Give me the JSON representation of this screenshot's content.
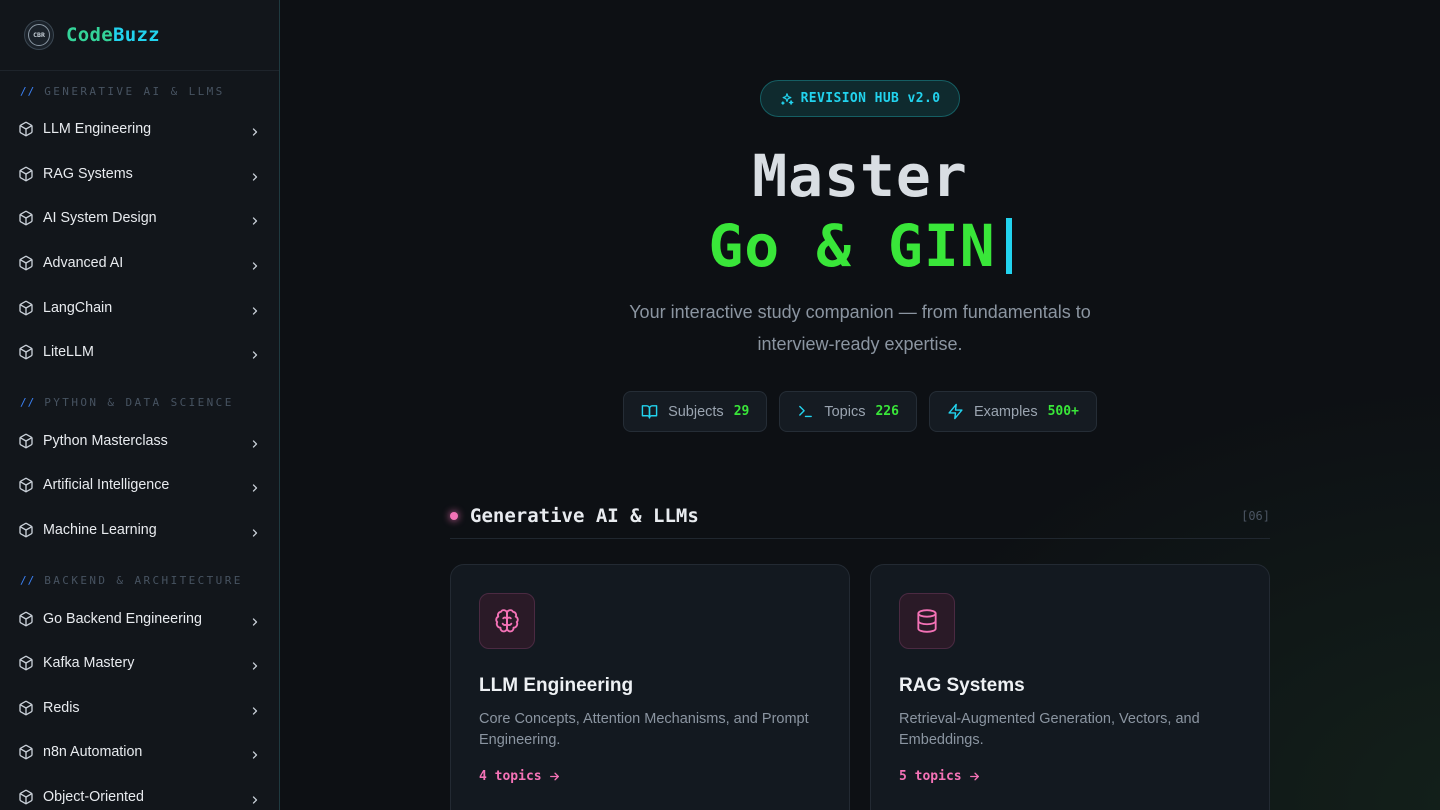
{
  "brand": {
    "name_part1": "Code",
    "name_part2": "Buzz",
    "logo_text": "CBR"
  },
  "sidebar": {
    "sections": [
      {
        "title": "Generative AI & LLMs",
        "items": [
          "LLM Engineering",
          "RAG Systems",
          "AI System Design",
          "Advanced AI",
          "LangChain",
          "LiteLLM"
        ]
      },
      {
        "title": "Python & Data Science",
        "items": [
          "Python Masterclass",
          "Artificial Intelligence",
          "Machine Learning"
        ]
      },
      {
        "title": "Backend & Architecture",
        "items": [
          "Go Backend Engineering",
          "Kafka Mastery",
          "Redis",
          "n8n Automation",
          "Object-Oriented"
        ]
      }
    ],
    "slash": "//"
  },
  "hero": {
    "badge": "REVISION HUB v2.0",
    "title_line1": "Master",
    "title_line2": "Go & GIN",
    "subtitle": "Your interactive study companion — from fundamentals to interview-ready expertise."
  },
  "stats": [
    {
      "label": "Subjects",
      "value": "29",
      "icon": "book-open-icon"
    },
    {
      "label": "Topics",
      "value": "226",
      "icon": "terminal-icon"
    },
    {
      "label": "Examples",
      "value": "500+",
      "icon": "lightning-icon"
    }
  ],
  "category": {
    "title": "Generative AI & LLMs",
    "count": "[06]"
  },
  "cards": [
    {
      "title": "LLM Engineering",
      "description": "Core Concepts, Attention Mechanisms, and Prompt Engineering.",
      "link": "4 topics",
      "icon": "brain-icon"
    },
    {
      "title": "RAG Systems",
      "description": "Retrieval-Augmented Generation, Vectors, and Embeddings.",
      "link": "5 topics",
      "icon": "database-icon"
    }
  ],
  "colors": {
    "accent_green": "#39e639",
    "accent_cyan": "#22d3ee",
    "accent_pink": "#f472b6"
  }
}
